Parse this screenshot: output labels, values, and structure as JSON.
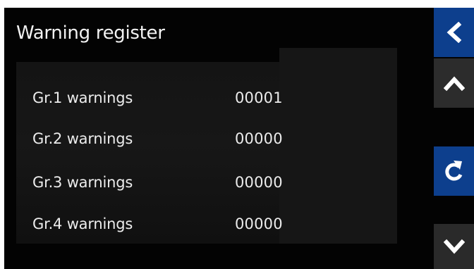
{
  "header": {
    "title": "Warning register"
  },
  "rows": [
    {
      "label": "Gr.1 warnings",
      "value": "00001"
    },
    {
      "label": "Gr.2 warnings",
      "value": "00000"
    },
    {
      "label": "Gr.3 warnings",
      "value": "00000"
    },
    {
      "label": "Gr.4 warnings",
      "value": "00000"
    }
  ],
  "nav": {
    "back": {
      "icon": "chevron-left-icon"
    },
    "up": {
      "icon": "chevron-up-icon"
    },
    "refresh": {
      "icon": "refresh-icon"
    },
    "down": {
      "icon": "chevron-down-icon"
    }
  },
  "colors": {
    "background": "#030303",
    "text": "#ececec",
    "accent_button": "#0d3f8d",
    "dark_button": "#2c2c2c",
    "icon": "#ffffff"
  }
}
